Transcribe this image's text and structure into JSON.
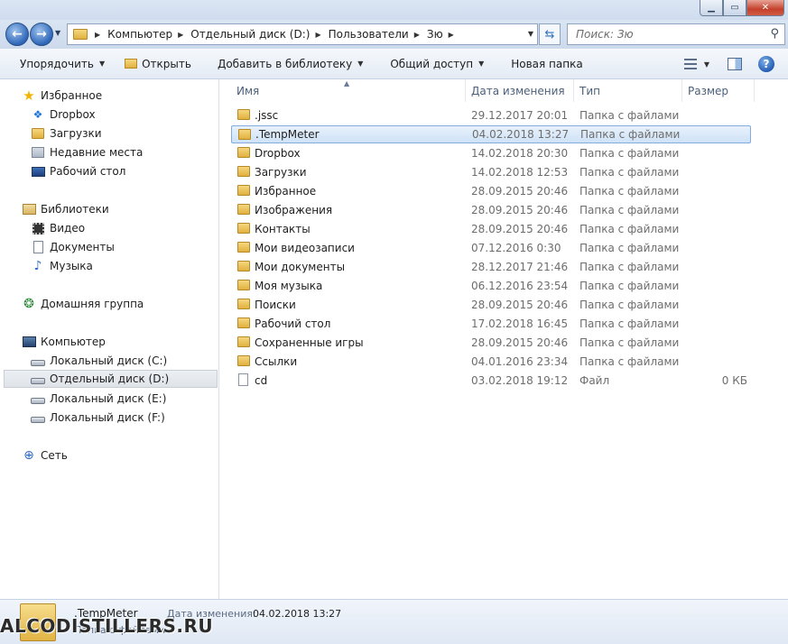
{
  "address": {
    "crumbs": [
      "Компьютер",
      "Отдельный диск (D:)",
      "Пользователи",
      "Зю"
    ]
  },
  "search": {
    "placeholder": "Поиск: Зю"
  },
  "toolbar": {
    "organize": "Упорядочить",
    "open": "Открыть",
    "add_to_library": "Добавить в библиотеку",
    "share": "Общий доступ",
    "new_folder": "Новая папка"
  },
  "nav": {
    "favorites": "Избранное",
    "dropbox": "Dropbox",
    "downloads": "Загрузки",
    "recent": "Недавние места",
    "desktop": "Рабочий стол",
    "libraries": "Библиотеки",
    "video": "Видео",
    "documents": "Документы",
    "music": "Музыка",
    "homegroup": "Домашняя группа",
    "computer": "Компьютер",
    "drive_c": "Локальный диск (C:)",
    "drive_d": "Отдельный диск (D:)",
    "drive_e": "Локальный диск (E:)",
    "drive_f": "Локальный диск (F:)",
    "network": "Сеть"
  },
  "columns": {
    "name": "Имя",
    "date": "Дата изменения",
    "type": "Тип",
    "size": "Размер"
  },
  "files": [
    {
      "name": ".jssc",
      "date": "29.12.2017 20:01",
      "type": "Папка с файлами",
      "size": ""
    },
    {
      "name": ".TempMeter",
      "date": "04.02.2018 13:27",
      "type": "Папка с файлами",
      "size": ""
    },
    {
      "name": "Dropbox",
      "date": "14.02.2018 20:30",
      "type": "Папка с файлами",
      "size": ""
    },
    {
      "name": "Загрузки",
      "date": "14.02.2018 12:53",
      "type": "Папка с файлами",
      "size": ""
    },
    {
      "name": "Избранное",
      "date": "28.09.2015 20:46",
      "type": "Папка с файлами",
      "size": ""
    },
    {
      "name": "Изображения",
      "date": "28.09.2015 20:46",
      "type": "Папка с файлами",
      "size": ""
    },
    {
      "name": "Контакты",
      "date": "28.09.2015 20:46",
      "type": "Папка с файлами",
      "size": ""
    },
    {
      "name": "Мои видеозаписи",
      "date": "07.12.2016 0:30",
      "type": "Папка с файлами",
      "size": ""
    },
    {
      "name": "Мои документы",
      "date": "28.12.2017 21:46",
      "type": "Папка с файлами",
      "size": ""
    },
    {
      "name": "Моя музыка",
      "date": "06.12.2016 23:54",
      "type": "Папка с файлами",
      "size": ""
    },
    {
      "name": "Поиски",
      "date": "28.09.2015 20:46",
      "type": "Папка с файлами",
      "size": ""
    },
    {
      "name": "Рабочий стол",
      "date": "17.02.2018 16:45",
      "type": "Папка с файлами",
      "size": ""
    },
    {
      "name": "Сохраненные игры",
      "date": "28.09.2015 20:46",
      "type": "Папка с файлами",
      "size": ""
    },
    {
      "name": "Ссылки",
      "date": "04.01.2016 23:34",
      "type": "Папка с файлами",
      "size": ""
    },
    {
      "name": "cd",
      "date": "03.02.2018 19:12",
      "type": "Файл",
      "size": "0 КБ"
    }
  ],
  "details": {
    "name": ".TempMeter",
    "date_label": "Дата изменения:",
    "date_value": "04.02.2018 13:27",
    "type": "Папка с файлами"
  },
  "watermark": "ALCODISTILLERS.RU"
}
